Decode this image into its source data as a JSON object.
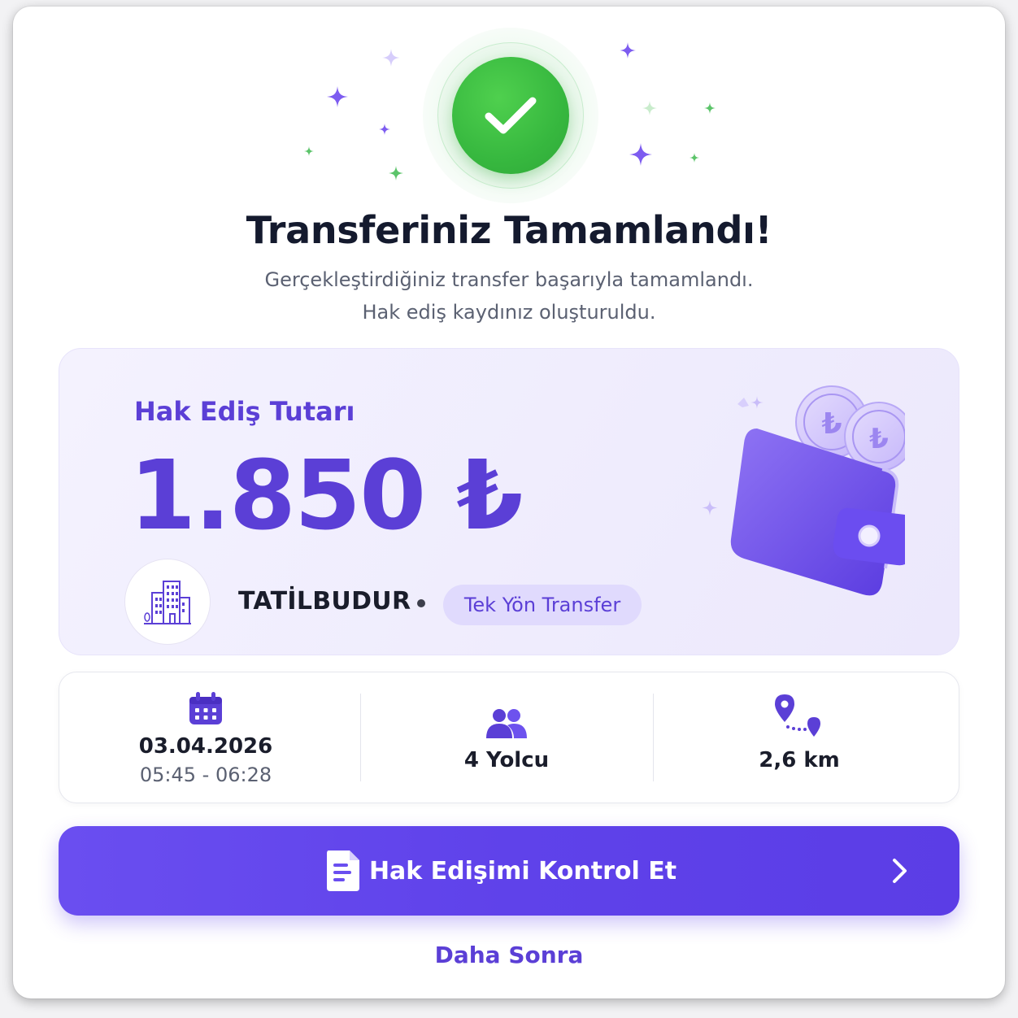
{
  "header": {
    "title": "Transferiniz Tamamlandı!",
    "subtitle_line1": "Gerçekleştirdiğiniz transfer başarıyla tamamlandı.",
    "subtitle_line2": "Hak ediş kaydınız oluşturuldu.",
    "status_icon": "check-circle-icon",
    "success_color": "#37b83f"
  },
  "amount_card": {
    "label": "Hak Ediş Tutarı",
    "amount": "1.850 ₺",
    "agency_name": "TATİLBUDUR",
    "agency_logo_icon": "building-icon",
    "transfer_type": "Tek Yön Transfer",
    "illustration": "wallet-with-coins-icon",
    "accent_color": "#5b3fd6"
  },
  "details": {
    "date": "03.04.2026",
    "time_range": "05:45 - 06:28",
    "date_icon": "calendar-icon",
    "passengers": "4 Yolcu",
    "passengers_icon": "users-icon",
    "distance": "2,6 km",
    "distance_icon": "route-pin-icon"
  },
  "actions": {
    "primary_label": "Hak Edişimi Kontrol Et",
    "primary_icon": "document-icon",
    "primary_chevron": "chevron-right-icon",
    "secondary_label": "Daha Sonra"
  }
}
